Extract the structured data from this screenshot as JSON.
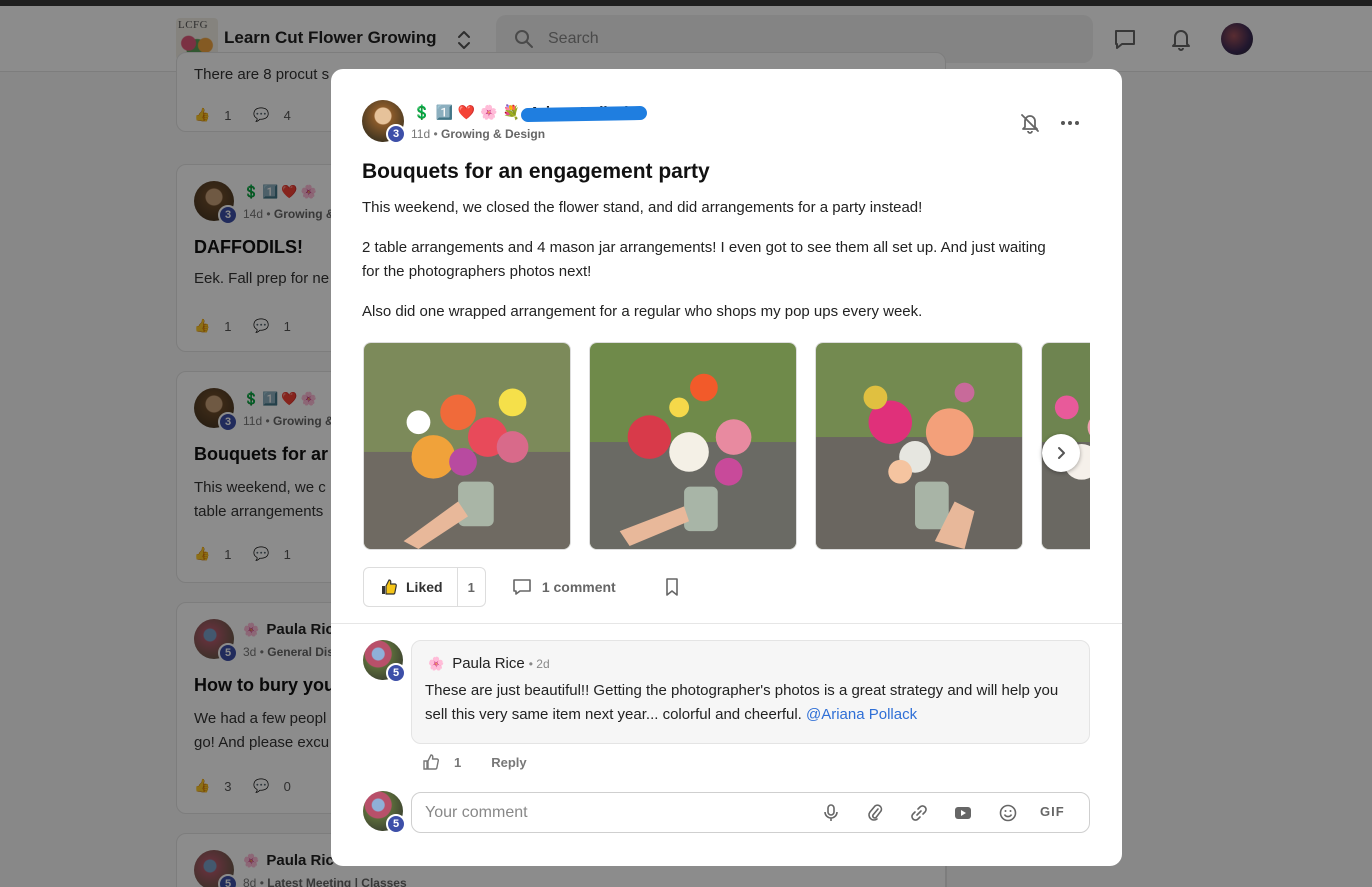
{
  "header": {
    "logo_text": "LCFG",
    "community_name": "Learn Cut Flower Growing",
    "search_placeholder": "Search"
  },
  "background_feed": {
    "cards": [
      {
        "snippet": "There are 8 procut s",
        "likes": "1",
        "comments": "4"
      },
      {
        "time": "14d",
        "category": "Growing &",
        "level": "3",
        "title": "DAFFODILS!",
        "text": "Eek. Fall prep for ne",
        "likes": "1",
        "comments": "1"
      },
      {
        "time": "11d",
        "category": "Growing &",
        "level": "3",
        "title": "Bouquets for ar",
        "text_line1": "This weekend, we c",
        "text_line2": "table arrangements",
        "likes": "1",
        "comments": "1"
      },
      {
        "name": "Paula Ric",
        "time": "3d",
        "category": "General Dis",
        "level": "5",
        "title": "How to bury you",
        "text_line1": "We had a few peopl",
        "text_line2": "go! And please excu",
        "likes": "3",
        "comments": "0"
      },
      {
        "name": "Paula Ric",
        "time": "8d",
        "category": "Latest Meeting | Classes",
        "level": "5"
      }
    ]
  },
  "post": {
    "author_level": "3",
    "author_badges": [
      "💲",
      "1️⃣",
      "❤️",
      "🌸",
      "💐"
    ],
    "author_name": "Ariana Pollack",
    "time": "11d",
    "category": "Growing & Design",
    "title": "Bouquets for an engagement party",
    "paragraphs": [
      "This weekend, we closed the flower stand, and did arrangements for a party instead!",
      "2 table arrangements and 4 mason jar arrangements! I even got to see them all set up. And just waiting for the photographers photos next!",
      "Also did one wrapped arrangement for a regular who shops my pop ups every week."
    ],
    "like_label": "Liked",
    "like_count": "1",
    "comment_label": "1 comment"
  },
  "comment": {
    "author_badge": "🌸",
    "author_name": "Paula Rice",
    "time": "2d",
    "author_level": "5",
    "text": "These are just beautiful!! Getting the photographer's photos is a great strategy and will help you sell this very same item next year... colorful and cheerful. ",
    "mention": "@Ariana Pollack",
    "like_count": "1",
    "reply_label": "Reply"
  },
  "composer": {
    "placeholder": "Your comment",
    "user_level": "5",
    "gif_label": "GIF"
  },
  "colors": {
    "level_badge": "#3d4fa8",
    "mention": "#2f6fd6"
  }
}
